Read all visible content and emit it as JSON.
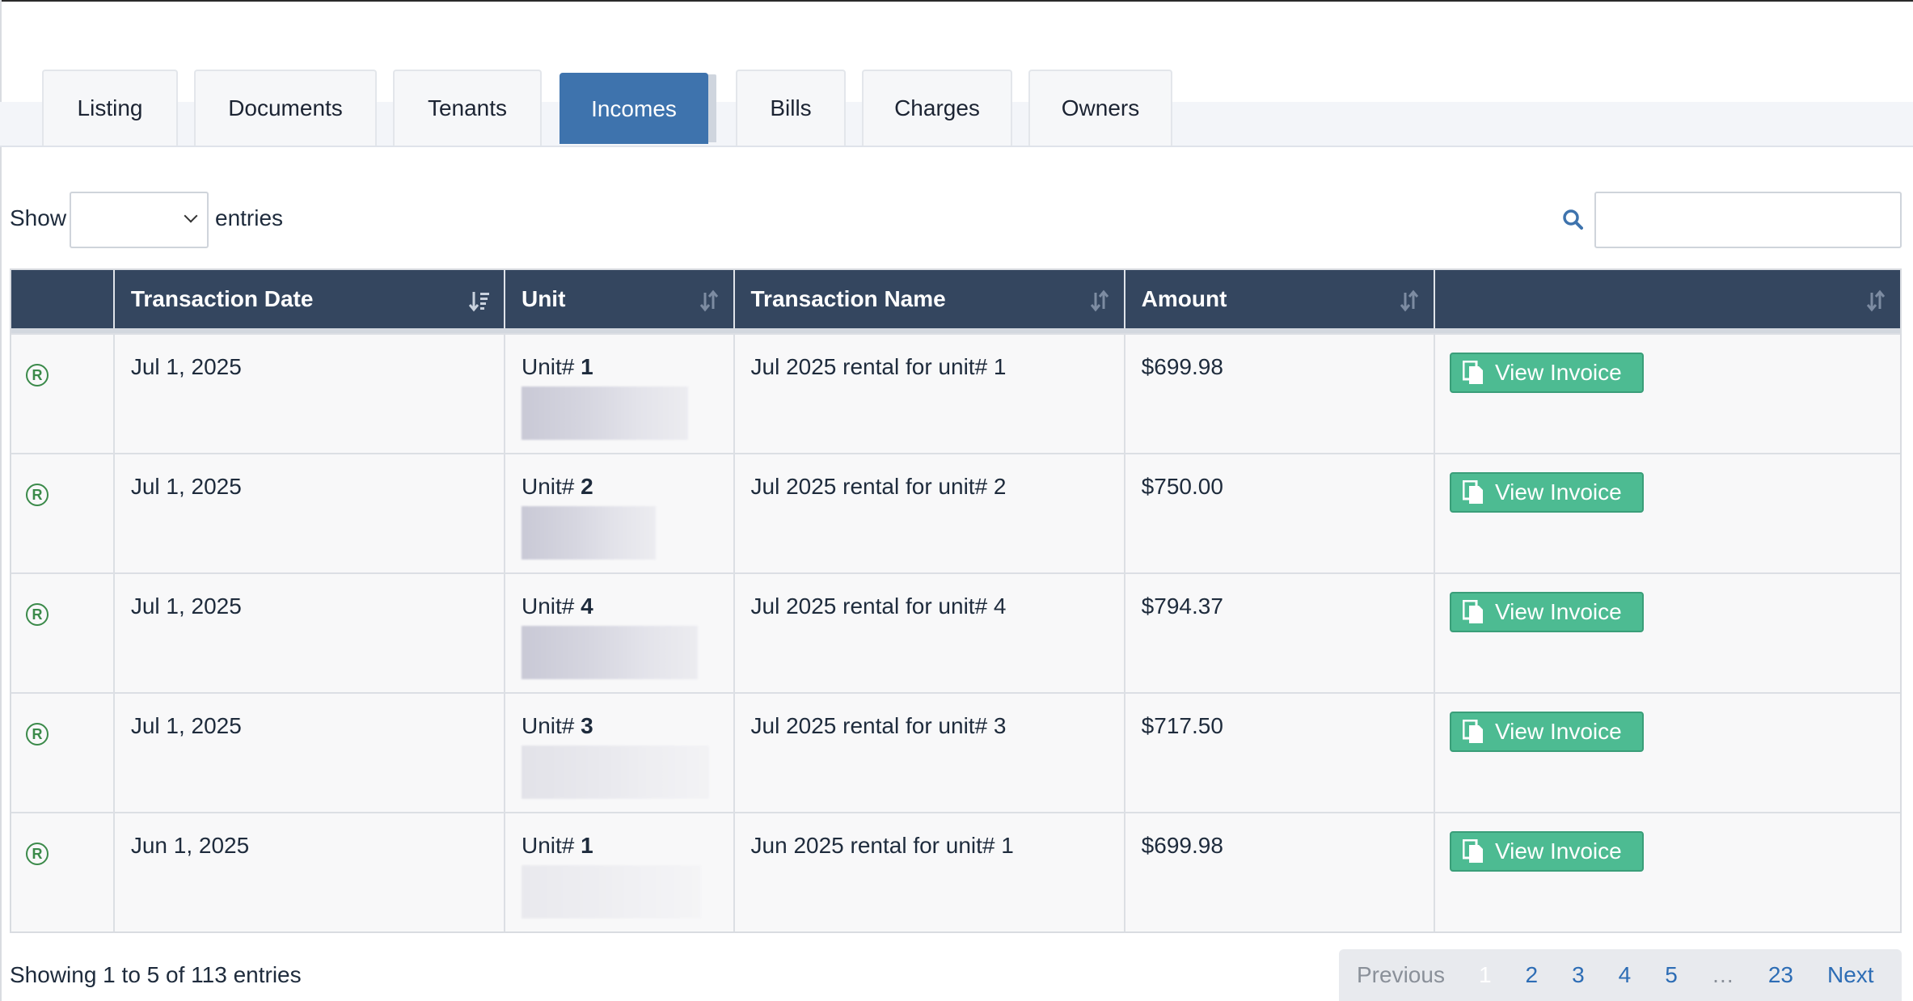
{
  "tabs": [
    "Listing",
    "Documents",
    "Tenants",
    "Incomes",
    "Bills",
    "Charges",
    "Owners"
  ],
  "active_tab": "Incomes",
  "controls": {
    "show_label": "Show",
    "entries_label": "entries",
    "page_size_value": "",
    "search_value": ""
  },
  "table": {
    "headers": [
      "",
      "Transaction Date",
      "Unit",
      "Transaction Name",
      "Amount",
      ""
    ],
    "sorted_column": "Transaction Date",
    "rows": [
      {
        "date": "Jul 1, 2025",
        "unit_prefix": "Unit#",
        "unit_number": "1",
        "name": "Jul 2025 rental for unit# 1",
        "amount": "$699.98",
        "action": "View Invoice"
      },
      {
        "date": "Jul 1, 2025",
        "unit_prefix": "Unit#",
        "unit_number": "2",
        "name": "Jul 2025 rental for unit# 2",
        "amount": "$750.00",
        "action": "View Invoice"
      },
      {
        "date": "Jul 1, 2025",
        "unit_prefix": "Unit#",
        "unit_number": "4",
        "name": "Jul 2025 rental for unit# 4",
        "amount": "$794.37",
        "action": "View Invoice"
      },
      {
        "date": "Jul 1, 2025",
        "unit_prefix": "Unit#",
        "unit_number": "3",
        "name": "Jul 2025 rental for unit# 3",
        "amount": "$717.50",
        "action": "View Invoice"
      },
      {
        "date": "Jun 1, 2025",
        "unit_prefix": "Unit#",
        "unit_number": "1",
        "name": "Jun 2025 rental for unit# 1",
        "amount": "$699.98",
        "action": "View Invoice"
      }
    ]
  },
  "footer": {
    "info": "Showing 1 to 5 of 113 entries",
    "pagination": {
      "previous": "Previous",
      "pages": [
        "1",
        "2",
        "3",
        "4",
        "5",
        "…",
        "23"
      ],
      "current": "1",
      "next": "Next"
    }
  },
  "colors": {
    "header_bg": "#34465f",
    "active_tab": "#3e73ad",
    "button": "#4dbb92",
    "registered_icon": "#3b8a4a",
    "link": "#2d6db5"
  },
  "icons": {
    "row_status": "registered-icon",
    "search": "search-icon",
    "sort": "sort-icon",
    "invoice": "document-icon"
  }
}
